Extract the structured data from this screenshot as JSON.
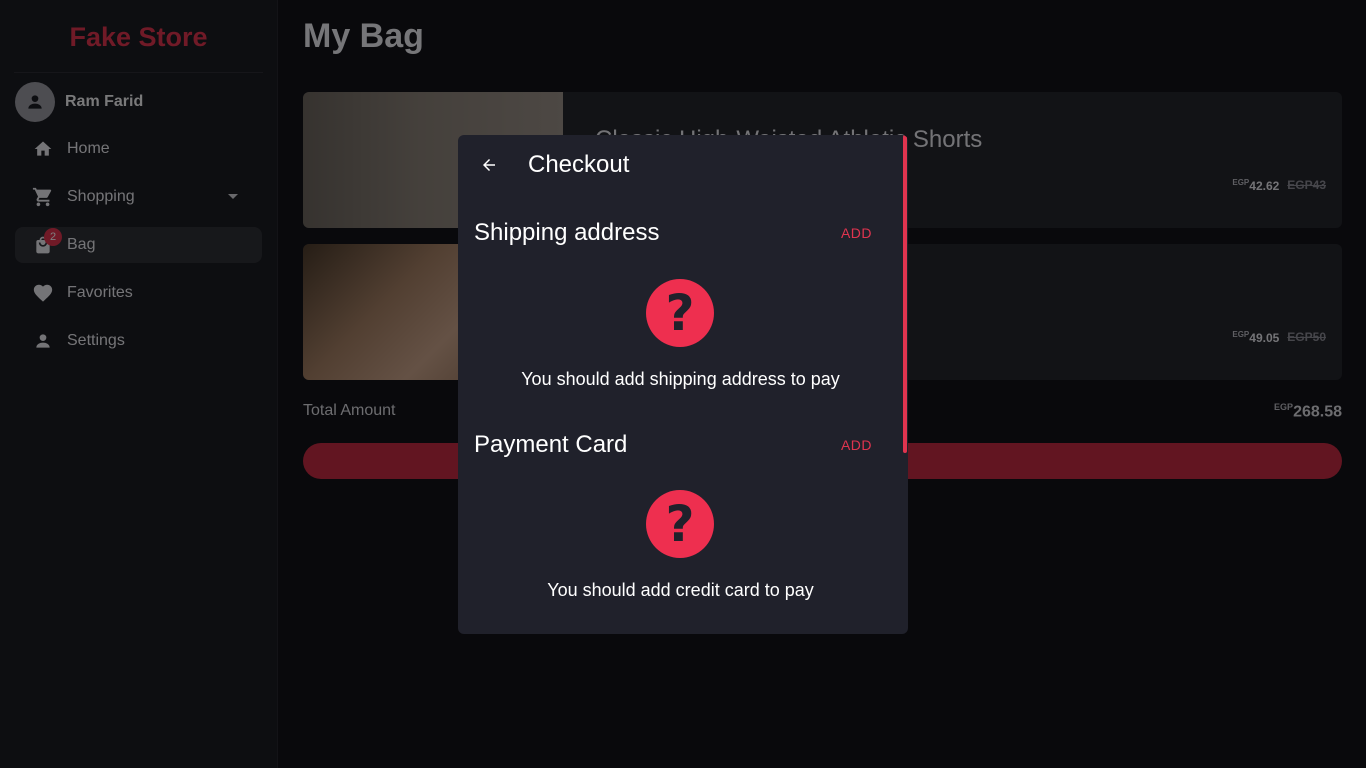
{
  "brand": "Fake Store",
  "user": {
    "name": "Ram Farid"
  },
  "nav": [
    {
      "label": "Home",
      "icon": "home-icon"
    },
    {
      "label": "Shopping",
      "icon": "cart-icon"
    },
    {
      "label": "Bag",
      "icon": "bag-icon",
      "badge": "2",
      "active": true
    },
    {
      "label": "Favorites",
      "icon": "heart-icon"
    },
    {
      "label": "Settings",
      "icon": "person-icon"
    }
  ],
  "main": {
    "title": "My Bag",
    "items": [
      {
        "title": "Classic High-Waisted Athletic Shorts",
        "currency": "EGP",
        "price": "42.62",
        "old_price": "EGP43"
      },
      {
        "title": "",
        "currency": "EGP",
        "price": "49.05",
        "old_price": "EGP50"
      }
    ],
    "total_label": "Total Amount",
    "total_currency": "EGP",
    "total_value": "268.58"
  },
  "dialog": {
    "title": "Checkout",
    "shipping": {
      "title": "Shipping address",
      "add": "ADD",
      "message": "You should add shipping address to pay",
      "icon_glyph": "?"
    },
    "payment": {
      "title": "Payment Card",
      "add": "ADD",
      "message": "You should add credit card to pay",
      "icon_glyph": "?"
    }
  },
  "colors": {
    "accent": "#e0344f",
    "background": "#131319",
    "dialog": "#20212b"
  }
}
